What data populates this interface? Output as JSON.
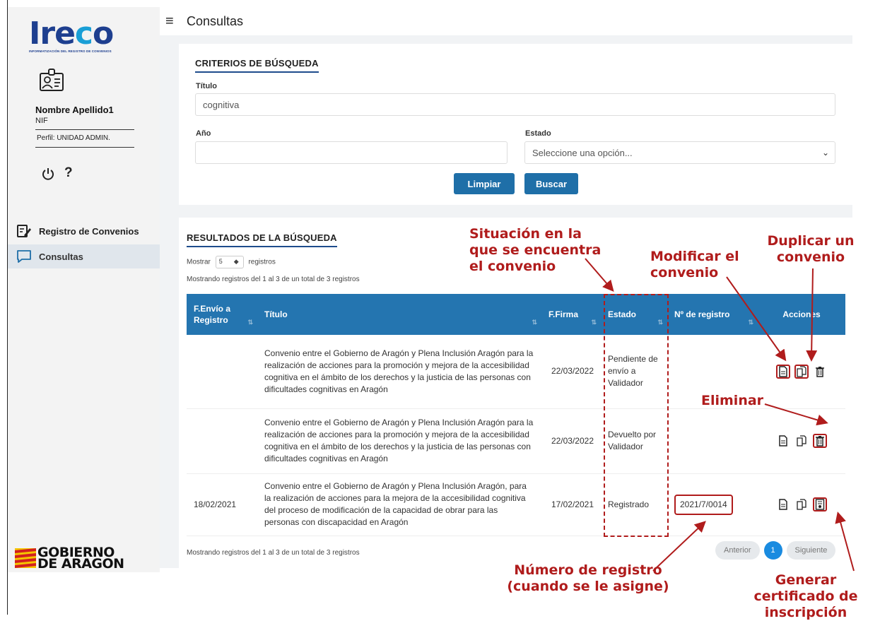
{
  "app": {
    "logo_text_1": "Ire",
    "logo_text_2": "c",
    "logo_text_3": "o",
    "logo_subtitle": "INFORMATIZACIÓN DEL REGISTRO DE CONVENIOS",
    "footer_logo_line1": "GOBIERNO",
    "footer_logo_line2": "DE ARAGON"
  },
  "user": {
    "name": "Nombre Apellido1",
    "nif": "NIF",
    "perfil": "Perfil: UNIDAD ADMIN.",
    "help_glyph": "?"
  },
  "sidebar": {
    "items": [
      {
        "label": "Registro de Convenios",
        "icon": "edit-document-icon"
      },
      {
        "label": "Consultas",
        "icon": "chat-icon"
      }
    ]
  },
  "header": {
    "title": "Consultas"
  },
  "criteria": {
    "section_title": "CRITERIOS DE BÚSQUEDA",
    "titulo_label": "Título",
    "titulo_value": "cognitiva",
    "anio_label": "Año",
    "anio_value": "",
    "estado_label": "Estado",
    "estado_value": "Seleccione una opción...",
    "clear_label": "Limpiar",
    "search_label": "Buscar"
  },
  "results": {
    "section_title": "RESULTADOS DE LA BÚSQUEDA",
    "show_prefix": "Mostrar",
    "show_value": "5",
    "show_suffix": "registros",
    "info_top": "Mostrando registros del 1 al 3 de un total de 3 registros",
    "info_bottom": "Mostrando registros del 1 al 3 de un total de 3 registros",
    "columns": [
      "F.Envío a Registro",
      "Título",
      "F.Firma",
      "Estado",
      "Nº de registro",
      "Acciones"
    ],
    "rows": [
      {
        "envio": "",
        "titulo": "Convenio entre el Gobierno de Aragón y Plena Inclusión Aragón para la realización de acciones para la promoción y mejora de la accesibilidad cognitiva en el ámbito de los derechos y la justicia de las personas con dificultades cognitivas en Aragón",
        "firma": "22/03/2022",
        "estado": "Pendiente de envío a Validador",
        "registro": ""
      },
      {
        "envio": "",
        "titulo": "Convenio entre el Gobierno de Aragón y Plena Inclusión Aragón para la realización de acciones para la promoción y mejora de la accesibilidad cognitiva en el ámbito de los derechos y la justicia de las personas con dificultades cognitivas en Aragón",
        "firma": "22/03/2022",
        "estado": "Devuelto por Validador",
        "registro": ""
      },
      {
        "envio": "18/02/2021",
        "titulo": "Convenio entre el Gobierno de Aragón y Plena Inclusión Aragón, para la realización de acciones para la mejora de la accesibilidad cognitiva del proceso de modificación de la capacidad de obrar para las personas con discapacidad en Aragón",
        "firma": "17/02/2021",
        "estado": "Registrado",
        "registro": "2021/7/0014"
      }
    ],
    "pager": {
      "prev": "Anterior",
      "page": "1",
      "next": "Siguiente"
    }
  },
  "annotations": {
    "situacion": "Situación en la que se encuentra el convenio",
    "modificar": "Modificar el convenio",
    "duplicar": "Duplicar un convenio",
    "eliminar": "Eliminar",
    "numero": "Número de registro (cuando se le asigne)",
    "certificado": "Generar certificado de inscripción"
  },
  "colors": {
    "header_blue": "#2475b0",
    "button_blue": "#1f6fa8",
    "annotation_red": "#b01c1c",
    "logo_blue": "#1e3f8f"
  }
}
